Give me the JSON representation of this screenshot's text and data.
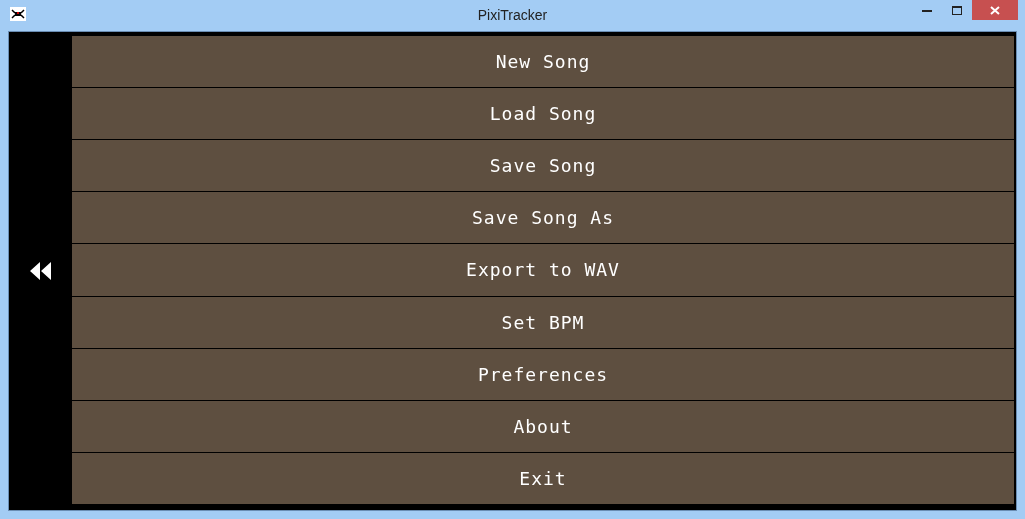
{
  "window": {
    "title": "PixiTracker"
  },
  "menu": [
    {
      "label": "New Song"
    },
    {
      "label": "Load Song"
    },
    {
      "label": "Save Song"
    },
    {
      "label": "Save Song As"
    },
    {
      "label": "Export to WAV"
    },
    {
      "label": "Set BPM"
    },
    {
      "label": "Preferences"
    },
    {
      "label": "About"
    },
    {
      "label": "Exit"
    }
  ]
}
